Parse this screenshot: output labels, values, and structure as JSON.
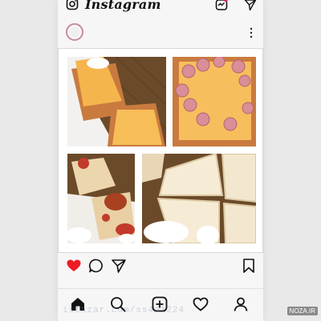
{
  "app": {
    "title": "Instagram"
  },
  "header": {
    "camera_icon": "camera-icon",
    "activity_icon": "activity-icon",
    "direct_icon": "send-icon",
    "notification_dot_color": "#e0245e"
  },
  "post": {
    "more_icon": "more-vertical-icon",
    "like_color": "#ed1c24",
    "liked": true,
    "images": [
      "bread with cheese slice",
      "cheese toast with sausage slices",
      "sandwich with sausage and sauce",
      "sandwich cut into triangles"
    ]
  },
  "actions": {
    "like_icon": "heart-filled-icon",
    "comment_icon": "comment-icon",
    "share_icon": "send-icon",
    "save_icon": "bookmark-icon"
  },
  "bottom_nav": [
    "home-icon",
    "search-icon",
    "add-icon",
    "heart-icon",
    "profile-icon"
  ],
  "watermark": {
    "left": "istazar.com/ss4d1224",
    "right": "NOZA.IR"
  }
}
